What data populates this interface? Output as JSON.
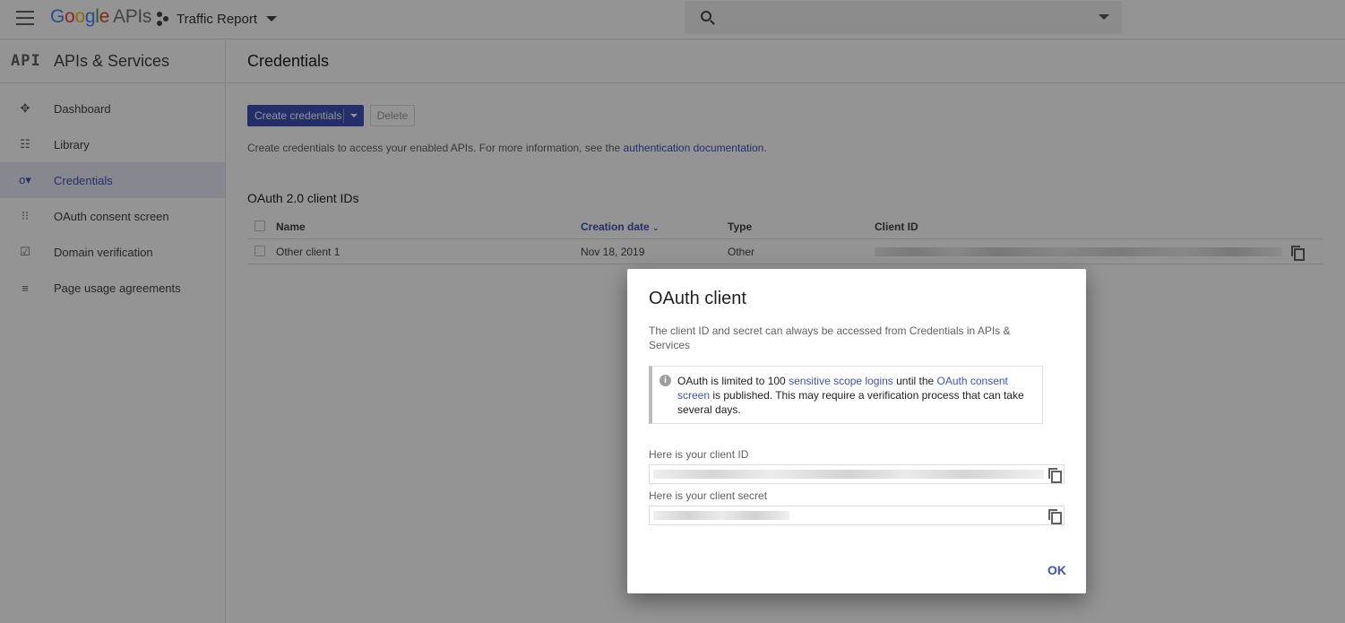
{
  "topbar": {
    "logo_google": "Google",
    "logo_apis": "APIs",
    "project_name": "Traffic Report"
  },
  "sidebar": {
    "badge": "API",
    "title": "APIs & Services",
    "items": [
      {
        "label": "Dashboard",
        "icon": "dashboard-icon",
        "active": false
      },
      {
        "label": "Library",
        "icon": "library-icon",
        "active": false
      },
      {
        "label": "Credentials",
        "icon": "key-icon",
        "active": true
      },
      {
        "label": "OAuth consent screen",
        "icon": "consent-icon",
        "active": false
      },
      {
        "label": "Domain verification",
        "icon": "domain-check-icon",
        "active": false
      },
      {
        "label": "Page usage agreements",
        "icon": "settings-list-icon",
        "active": false
      }
    ]
  },
  "main": {
    "title": "Credentials",
    "create_button": "Create credentials",
    "delete_button": "Delete",
    "info_prefix": "Create credentials to access your enabled APIs. For more information, see the ",
    "info_link": "authentication documentation",
    "info_suffix": ".",
    "section_title": "OAuth 2.0 client IDs",
    "table": {
      "headers": {
        "name": "Name",
        "creation_date": "Creation date",
        "type": "Type",
        "client_id": "Client ID"
      },
      "rows": [
        {
          "name": "Other client 1",
          "creation_date": "Nov 18, 2019",
          "type": "Other"
        }
      ]
    }
  },
  "dialog": {
    "title": "OAuth client",
    "description": "The client ID and secret can always be accessed from Credentials in APIs & Services",
    "notice_part1": "OAuth is limited to 100 ",
    "notice_link1": "sensitive scope logins",
    "notice_part2": " until the ",
    "notice_link2": "OAuth consent screen",
    "notice_part3": " is published. This may require a verification process that can take several days.",
    "client_id_label": "Here is your client ID",
    "client_secret_label": "Here is your client secret",
    "ok_button": "OK"
  },
  "colors": {
    "accent": "#3f51b5",
    "active_nav_bg": "#e8eaf6"
  }
}
